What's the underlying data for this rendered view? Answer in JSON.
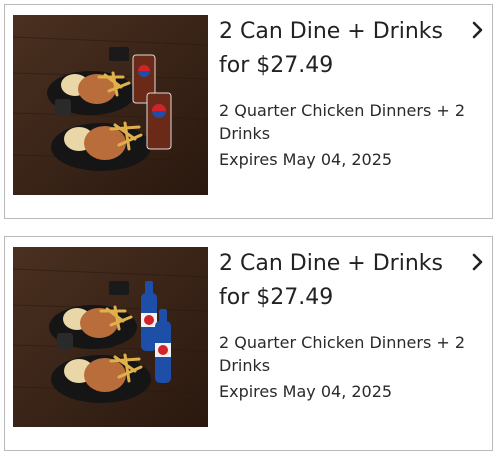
{
  "offers": [
    {
      "title": "2 Can Dine + Drinks for $27.49",
      "description": "2 Quarter Chicken Dinners + 2 Drinks",
      "expires": "Expires May 04, 2025",
      "image": "two-chicken-dinners-with-fountain-drinks",
      "chevron_icon": "chevron-right-icon"
    },
    {
      "title": "2 Can Dine + Drinks for $27.49",
      "description": "2 Quarter Chicken Dinners + 2 Drinks",
      "expires": "Expires May 04, 2025",
      "image": "two-chicken-dinners-with-bottled-drinks",
      "chevron_icon": "chevron-right-icon"
    }
  ],
  "colors": {
    "card_border": "#b9b9b9",
    "text": "#222222",
    "photo_background": "#3a2418",
    "pepsi_blue": "#1e4fa8",
    "pepsi_red": "#d3222a"
  }
}
